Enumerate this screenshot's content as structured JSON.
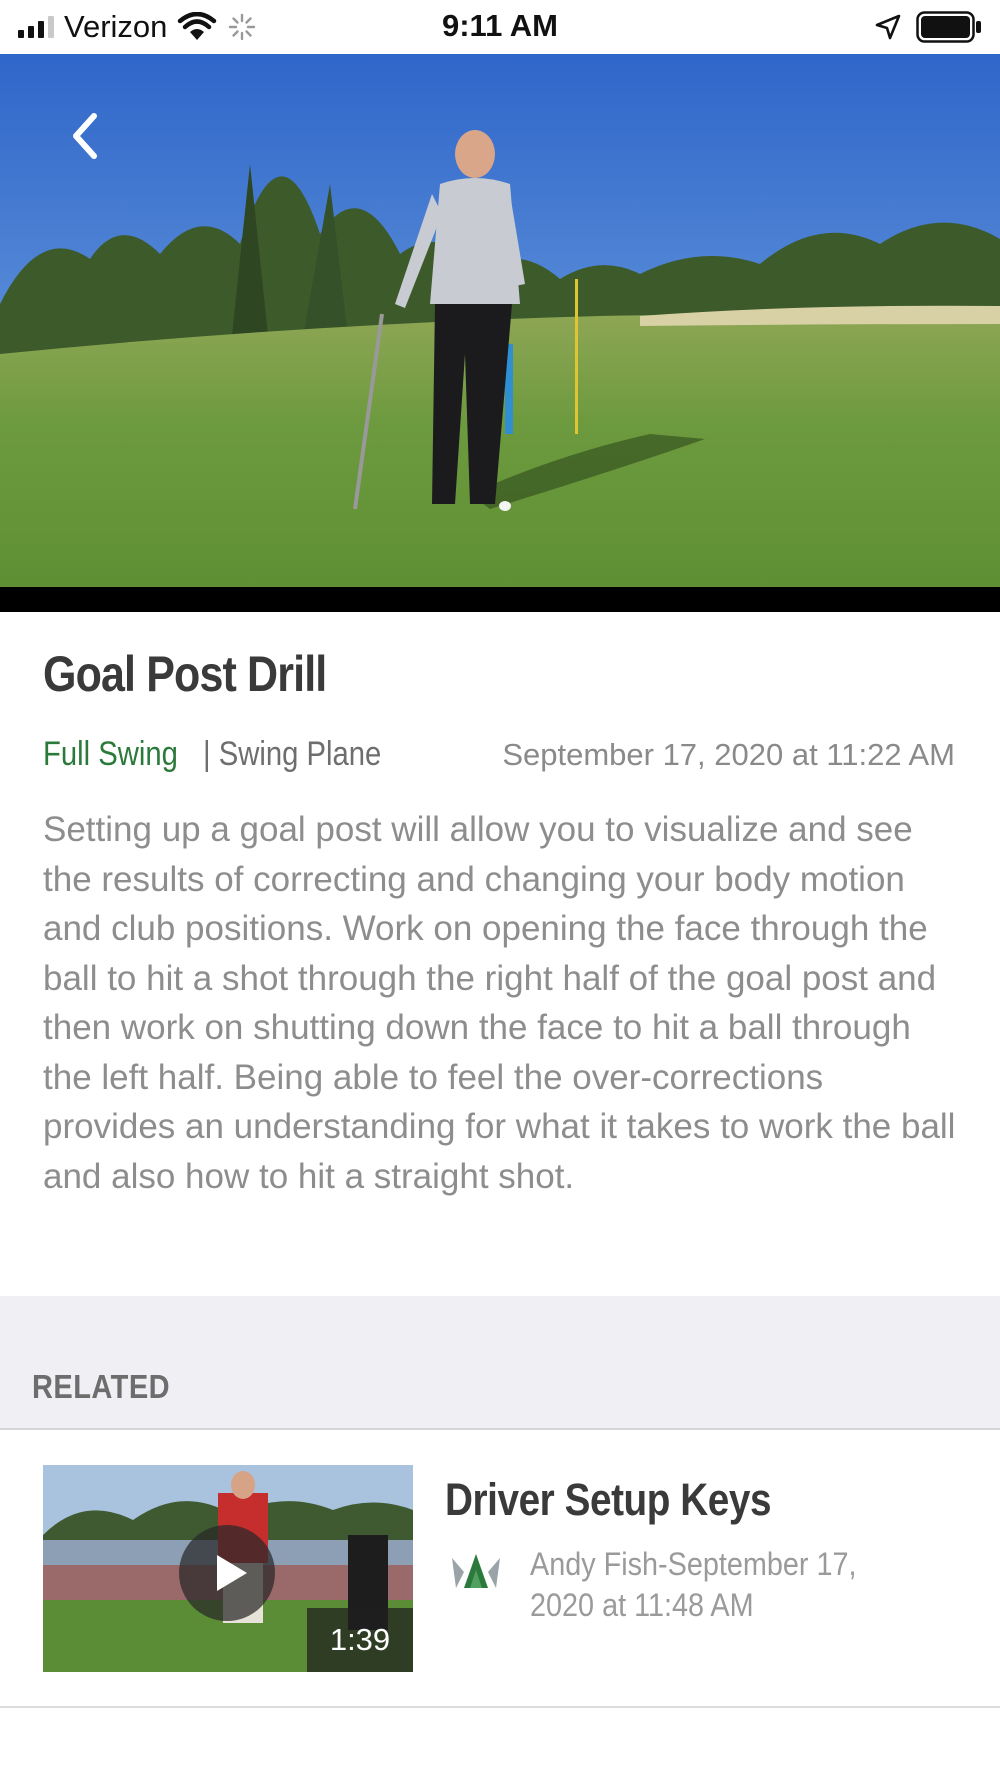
{
  "status_bar": {
    "carrier": "Verizon",
    "time": "9:11 AM",
    "icons": [
      "signal-icon",
      "wifi-icon",
      "activity-spinner-icon",
      "location-arrow-icon",
      "battery-icon"
    ]
  },
  "video": {
    "back_icon": "chevron-left-icon"
  },
  "article": {
    "title": "Goal Post Drill",
    "category": "Full Swing",
    "subcategory": "| Swing Plane",
    "date": "September 17, 2020 at 11:22 AM",
    "description": "Setting up a goal post will allow you to visualize and see the results of correcting and changing your body motion and club positions. Work on opening the face through the ball to hit a shot through the right half of the goal post and then work on shutting down the face to hit a ball through the left half. Being able to feel the over-corrections provides an understanding for what it takes to work the ball and also how to hit a straight shot."
  },
  "related": {
    "label": "RELATED",
    "items": [
      {
        "title": "Driver Setup Keys",
        "meta": "Andy Fish-September 17, 2020 at 11:48 AM",
        "duration": "1:39",
        "author_icon": "crown-logo-icon"
      }
    ]
  },
  "colors": {
    "accent_green": "#2c7a3b",
    "related_band": "#efeff4",
    "body_text": "#8d8d8d",
    "title_text": "#3a3a3a"
  }
}
